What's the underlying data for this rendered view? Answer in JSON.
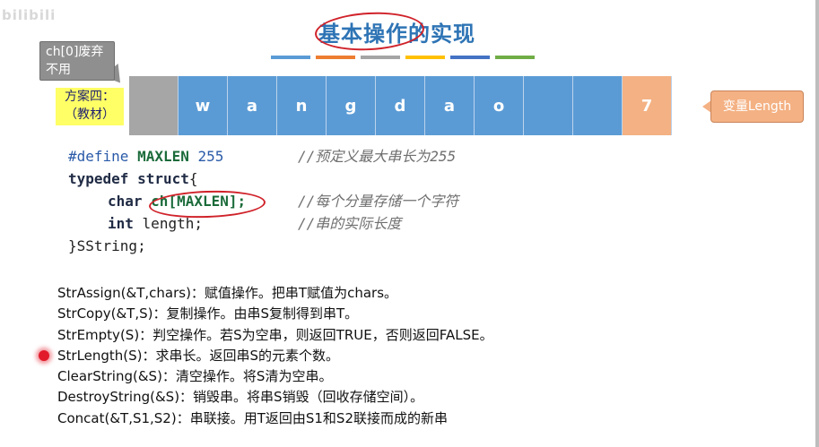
{
  "watermark": "bilibili",
  "title": "基本操作的实现",
  "title_bar_colors": [
    "#5b9bd5",
    "#ed7d31",
    "#a5a5a5",
    "#ffc000",
    "#4472c4",
    "#70ad47"
  ],
  "callout_ch0": "ch[0]废弃不用",
  "plan_label": {
    "line1": "方案四：",
    "line2": "（教材）"
  },
  "array": {
    "cells": [
      "",
      "w",
      "a",
      "n",
      "g",
      "d",
      "a",
      "o",
      "",
      "",
      "7"
    ],
    "colors": {
      "unused": "#a6a6a6",
      "data": "#5b9bd5",
      "length": "#f4b183"
    }
  },
  "length_callout": "变量Length",
  "code": {
    "line1": {
      "directive": "#define",
      "name": "MAXLEN",
      "value": "255",
      "comment": "//预定义最大串长为255"
    },
    "line2": {
      "kw1": "typedef",
      "kw2": "struct",
      "brace": "{"
    },
    "line3": {
      "type": "char",
      "decl": "ch[MAXLEN];",
      "comment": "//每个分量存储一个字符"
    },
    "line4": {
      "type": "int",
      "decl": "length;",
      "comment": "//串的实际长度"
    },
    "line5": "}SString;"
  },
  "operations": [
    "StrAssign(&T,chars)：赋值操作。把串T赋值为chars。",
    "StrCopy(&T,S)：复制操作。由串S复制得到串T。",
    "StrEmpty(S)：判空操作。若S为空串，则返回TRUE，否则返回FALSE。",
    "StrLength(S)：求串长。返回串S的元素个数。",
    "ClearString(&S)：清空操作。将S清为空串。",
    "DestroyString(&S)：销毁串。将串S销毁（回收存储空间）。",
    "Concat(&T,S1,S2)：串联接。用T返回由S1和S2联接而成的新串"
  ]
}
